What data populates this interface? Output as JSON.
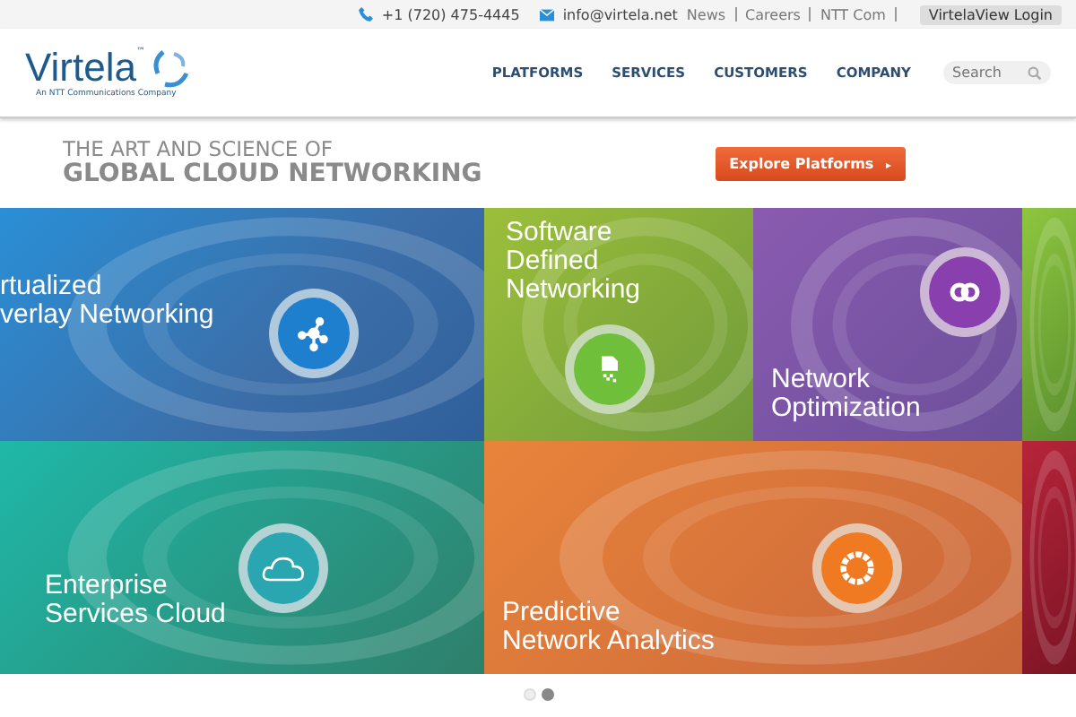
{
  "top_bar": {
    "phone": "+1 (720) 475-4445",
    "email": "info@virtela.net",
    "links": [
      "News",
      "Careers",
      "NTT Com"
    ],
    "login": "VirtelaView Login"
  },
  "header": {
    "logo": "Virtela",
    "logo_mark": "™",
    "tagline": "An NTT Communications Company",
    "nav": [
      "PLATFORMS",
      "SERVICES",
      "CUSTOMERS",
      "COMPANY"
    ],
    "search": {
      "placeholder": "Search"
    }
  },
  "hero": {
    "kicker": "THE ART AND SCIENCE OF",
    "title": "GLOBAL CLOUD NETWORKING",
    "button": "Explore Platforms",
    "button_icon": "▸"
  },
  "tiles": [
    {
      "kind": "overlay",
      "lines": [
        "rtualized",
        "verlay Networking"
      ]
    },
    {
      "kind": "sdn",
      "lines": [
        "Software",
        "Defined",
        "Networking"
      ]
    },
    {
      "kind": "optimization",
      "lines": [
        "Network",
        "Optimization"
      ]
    },
    {
      "kind": "edge-green"
    },
    {
      "kind": "cloud",
      "lines": [
        "Enterprise",
        "Services Cloud"
      ]
    },
    {
      "kind": "analytics",
      "lines": [
        "Predictive",
        "Network Analytics"
      ]
    },
    {
      "kind": "edge-red"
    }
  ],
  "carousel_dots": [
    {
      "selected": false
    },
    {
      "selected": true
    }
  ]
}
